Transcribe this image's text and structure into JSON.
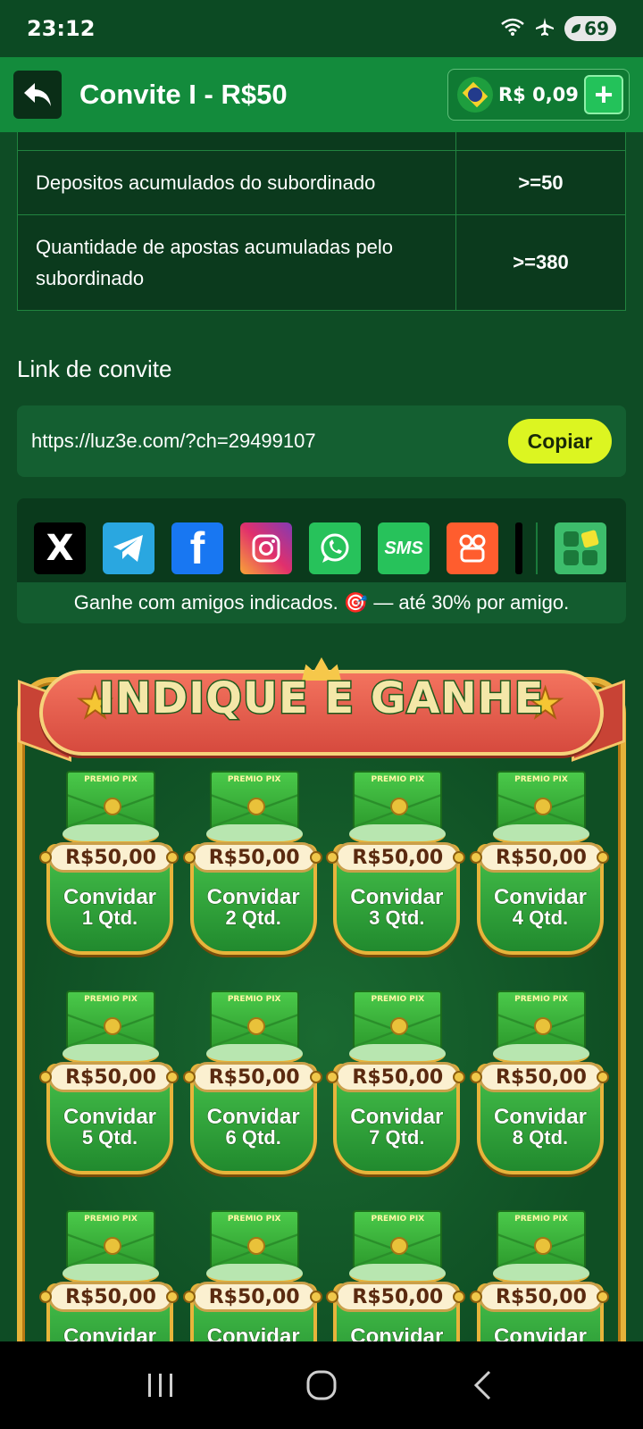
{
  "status_bar": {
    "time": "23:12",
    "battery": "69"
  },
  "header": {
    "title": "Convite I - R$50",
    "balance": "R$ 0,09",
    "plus_symbol": "+"
  },
  "requirements": [
    {
      "label": "Depositos acumulados do subordinado",
      "value": ">=50"
    },
    {
      "label": "Quantidade de apostas acumuladas pelo subordinado",
      "value": ">=380"
    }
  ],
  "invite": {
    "label": "Link de convite",
    "url": "https://luz3e.com/?ch=29499107",
    "copy_label": "Copiar"
  },
  "share": {
    "icons": [
      "x-icon",
      "telegram-icon",
      "facebook-icon",
      "instagram-icon",
      "whatsapp-icon",
      "sms-icon",
      "kwai-icon",
      "tiktok-icon",
      "more-apps-icon"
    ],
    "x_label": "X",
    "fb_label": "f",
    "sms_label": "SMS",
    "caption": "Ganhe com amigos indicados. 🎯 — até 30% por amigo."
  },
  "banner": {
    "title": "INDIQUE E GANHE",
    "envelope_label": "PREMIO PIX",
    "cards": [
      {
        "price": "R$50,00",
        "line1": "Convidar",
        "line2": "1 Qtd."
      },
      {
        "price": "R$50,00",
        "line1": "Convidar",
        "line2": "2 Qtd."
      },
      {
        "price": "R$50,00",
        "line1": "Convidar",
        "line2": "3 Qtd."
      },
      {
        "price": "R$50,00",
        "line1": "Convidar",
        "line2": "4 Qtd."
      },
      {
        "price": "R$50,00",
        "line1": "Convidar",
        "line2": "5 Qtd."
      },
      {
        "price": "R$50,00",
        "line1": "Convidar",
        "line2": "6 Qtd."
      },
      {
        "price": "R$50,00",
        "line1": "Convidar",
        "line2": "7 Qtd."
      },
      {
        "price": "R$50,00",
        "line1": "Convidar",
        "line2": "8 Qtd."
      },
      {
        "price": "R$50,00",
        "line1": "Convidar",
        "line2": ""
      },
      {
        "price": "R$50,00",
        "line1": "Convidar",
        "line2": ""
      },
      {
        "price": "R$50,00",
        "line1": "Convidar",
        "line2": ""
      },
      {
        "price": "R$50,00",
        "line1": "Convidar",
        "line2": ""
      }
    ]
  },
  "colors": {
    "header_bg": "#138b3c",
    "page_bg": "#0e4c25",
    "accent_yellow": "#ffe33a",
    "copy_button": "#dcf521"
  }
}
